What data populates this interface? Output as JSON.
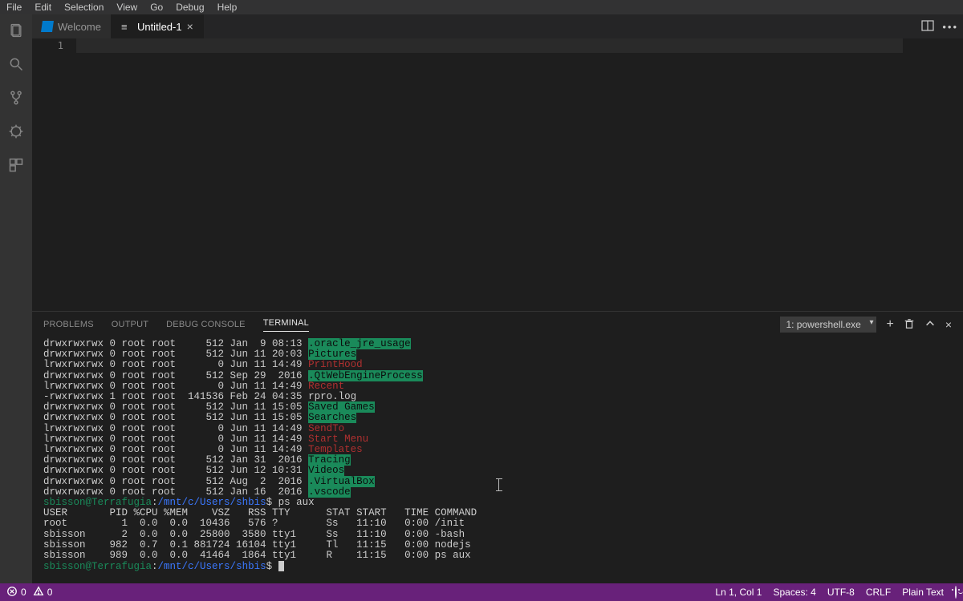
{
  "menubar": [
    "File",
    "Edit",
    "Selection",
    "View",
    "Go",
    "Debug",
    "Help"
  ],
  "tabs": {
    "welcome": "Welcome",
    "untitled": "Untitled-1"
  },
  "gutter": {
    "line1": "1"
  },
  "panel": {
    "tabs": {
      "problems": "PROBLEMS",
      "output": "OUTPUT",
      "debug": "DEBUG CONSOLE",
      "terminal": "TERMINAL"
    },
    "termselect": "1: powershell.exe"
  },
  "terminal": {
    "ls": [
      {
        "perm": "drwxrwxrwx",
        "n": "0",
        "own": "root root",
        "size": "    512",
        "date": "Jan  9 08:13",
        "name": ".oracle_jre_usage",
        "cls": "dir-hl"
      },
      {
        "perm": "drwxrwxrwx",
        "n": "0",
        "own": "root root",
        "size": "    512",
        "date": "Jun 11 20:03",
        "name": "Pictures",
        "cls": "dir-hl"
      },
      {
        "perm": "lrwxrwxrwx",
        "n": "0",
        "own": "root root",
        "size": "      0",
        "date": "Jun 11 14:49",
        "name": "PrintHood",
        "cls": "lnk"
      },
      {
        "perm": "drwxrwxrwx",
        "n": "0",
        "own": "root root",
        "size": "    512",
        "date": "Sep 29  2016",
        "name": ".QtWebEngineProcess",
        "cls": "dir-hl"
      },
      {
        "perm": "lrwxrwxrwx",
        "n": "0",
        "own": "root root",
        "size": "      0",
        "date": "Jun 11 14:49",
        "name": "Recent",
        "cls": "lnk"
      },
      {
        "perm": "-rwxrwxrwx",
        "n": "1",
        "own": "root root",
        "size": " 141536",
        "date": "Feb 24 04:35",
        "name": "rpro.log",
        "cls": "file"
      },
      {
        "perm": "drwxrwxrwx",
        "n": "0",
        "own": "root root",
        "size": "    512",
        "date": "Jun 11 15:05",
        "name": "Saved Games",
        "cls": "dir-hl"
      },
      {
        "perm": "drwxrwxrwx",
        "n": "0",
        "own": "root root",
        "size": "    512",
        "date": "Jun 11 15:05",
        "name": "Searches",
        "cls": "dir-hl"
      },
      {
        "perm": "lrwxrwxrwx",
        "n": "0",
        "own": "root root",
        "size": "      0",
        "date": "Jun 11 14:49",
        "name": "SendTo",
        "cls": "lnk"
      },
      {
        "perm": "lrwxrwxrwx",
        "n": "0",
        "own": "root root",
        "size": "      0",
        "date": "Jun 11 14:49",
        "name": "Start Menu",
        "cls": "lnk"
      },
      {
        "perm": "lrwxrwxrwx",
        "n": "0",
        "own": "root root",
        "size": "      0",
        "date": "Jun 11 14:49",
        "name": "Templates",
        "cls": "lnk"
      },
      {
        "perm": "drwxrwxrwx",
        "n": "0",
        "own": "root root",
        "size": "    512",
        "date": "Jan 31  2016",
        "name": "Tracing",
        "cls": "dir-hl"
      },
      {
        "perm": "drwxrwxrwx",
        "n": "0",
        "own": "root root",
        "size": "    512",
        "date": "Jun 12 10:31",
        "name": "Videos",
        "cls": "dir-hl"
      },
      {
        "perm": "drwxrwxrwx",
        "n": "0",
        "own": "root root",
        "size": "    512",
        "date": "Aug  2  2016",
        "name": ".VirtualBox",
        "cls": "dir-hl"
      },
      {
        "perm": "drwxrwxrwx",
        "n": "0",
        "own": "root root",
        "size": "    512",
        "date": "Jan 16  2016",
        "name": ".vscode",
        "cls": "dir-hl"
      }
    ],
    "prompt": {
      "user": "sbisson@Terrafugia",
      "sep": ":",
      "path": "/mnt/c/Users/shbis",
      "dollar": "$ ",
      "cmd": "ps aux"
    },
    "ps_header": "USER       PID %CPU %MEM    VSZ   RSS TTY      STAT START   TIME COMMAND",
    "ps": [
      "root         1  0.0  0.0  10436   576 ?        Ss   11:10   0:00 /init",
      "sbisson      2  0.0  0.0  25800  3580 tty1     Ss   11:10   0:00 -bash",
      "sbisson    982  0.7  0.1 881724 16104 tty1     Tl   11:15   0:00 nodejs",
      "sbisson    989  0.0  0.0  41464  1864 tty1     R    11:15   0:00 ps aux"
    ]
  },
  "status": {
    "errors": "0",
    "warnings": "0",
    "ln": "Ln 1, Col 1",
    "spaces": "Spaces: 4",
    "enc": "UTF-8",
    "eol": "CRLF",
    "lang": "Plain Text"
  }
}
